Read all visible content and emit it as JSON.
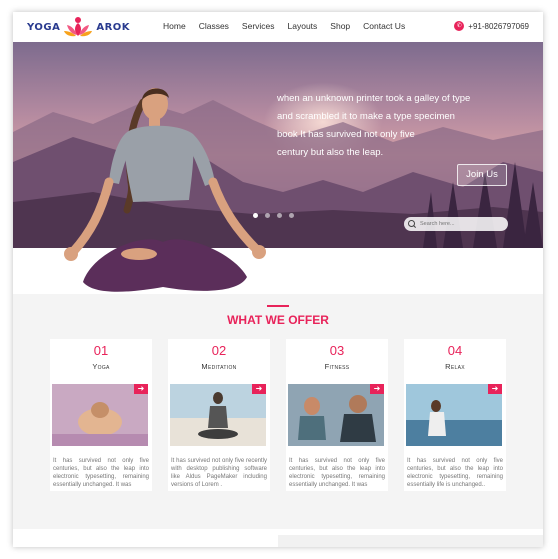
{
  "brand": {
    "word1": "YOGA",
    "word2": "AROK"
  },
  "nav": {
    "items": [
      "Home",
      "Classes",
      "Services",
      "Layouts",
      "Shop",
      "Contact Us"
    ]
  },
  "phone": {
    "icon": "phone-icon",
    "number": "+91-8026797069"
  },
  "hero": {
    "lines": [
      "when an unknown printer took a galley of type",
      "and scrambled it to make a type specimen",
      "book It has survived not only five",
      "century but also the leap."
    ],
    "join_label": "Join Us",
    "search_placeholder": "Search here...",
    "slides": 4,
    "active_slide": 0
  },
  "offer": {
    "heading": "WHAT WE OFFER",
    "cards": [
      {
        "num": "01",
        "title": "Yoga",
        "desc": "It has survived not only five centuries, but also the leap into electronic typesetting, remaining essentially unchanged. It was"
      },
      {
        "num": "02",
        "title": "Meditation",
        "desc": "It has survived not only five recently with desktop publishing software like Aldus PageMaker including versions of Lorem ."
      },
      {
        "num": "03",
        "title": "Fitness",
        "desc": "It has survived not only five centuries, but also the leap into electronic typesetting, remaining essentially unchanged. It was"
      },
      {
        "num": "04",
        "title": "Relax",
        "desc": "It has survived not only five centuries, but also the leap into electronic typesetting, remaining essentially life is unchanged.."
      }
    ]
  },
  "colors": {
    "accent": "#e8235a",
    "brand": "#2a3b8f"
  }
}
